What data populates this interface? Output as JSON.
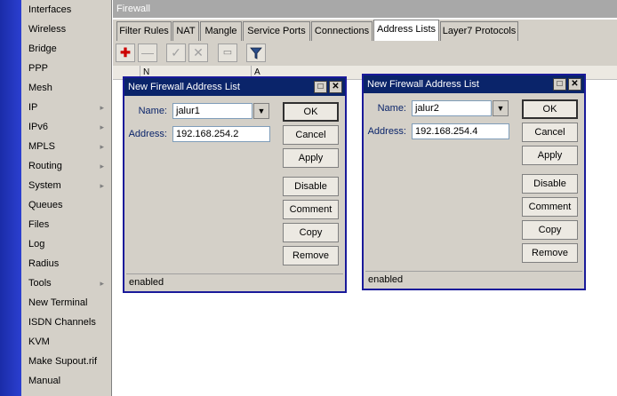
{
  "sidebar": {
    "items": [
      {
        "label": "Interfaces",
        "arrow": ""
      },
      {
        "label": "Wireless",
        "arrow": ""
      },
      {
        "label": "Bridge",
        "arrow": ""
      },
      {
        "label": "PPP",
        "arrow": ""
      },
      {
        "label": "Mesh",
        "arrow": ""
      },
      {
        "label": "IP",
        "arrow": "▸"
      },
      {
        "label": "IPv6",
        "arrow": "▸"
      },
      {
        "label": "MPLS",
        "arrow": "▸"
      },
      {
        "label": "Routing",
        "arrow": "▸"
      },
      {
        "label": "System",
        "arrow": "▸"
      },
      {
        "label": "Queues",
        "arrow": ""
      },
      {
        "label": "Files",
        "arrow": ""
      },
      {
        "label": "Log",
        "arrow": ""
      },
      {
        "label": "Radius",
        "arrow": ""
      },
      {
        "label": "Tools",
        "arrow": "▸"
      },
      {
        "label": "New Terminal",
        "arrow": ""
      },
      {
        "label": "ISDN Channels",
        "arrow": ""
      },
      {
        "label": "KVM",
        "arrow": ""
      },
      {
        "label": "Make Supout.rif",
        "arrow": ""
      },
      {
        "label": "Manual",
        "arrow": ""
      }
    ]
  },
  "firewall": {
    "title": "Firewall",
    "tabs": [
      "Filter Rules",
      "NAT",
      "Mangle",
      "Service Ports",
      "Connections",
      "Address Lists",
      "Layer7 Protocols"
    ],
    "active_tab": "Address Lists",
    "toolbar": {
      "add_icon": "plus-icon",
      "remove_icon": "minus-icon",
      "enable_icon": "check-icon",
      "disable_icon": "x-icon",
      "comment_icon": "comment-icon",
      "filter_icon": "filter-icon"
    },
    "columns": [
      "N",
      "A"
    ]
  },
  "dialogs": [
    {
      "title": "New Firewall Address List",
      "name_label": "Name:",
      "name_value": "jalur1",
      "address_label": "Address:",
      "address_value": "192.168.254.2",
      "buttons": [
        "OK",
        "Cancel",
        "Apply",
        "Disable",
        "Comment",
        "Copy",
        "Remove"
      ],
      "status": "enabled"
    },
    {
      "title": "New Firewall Address List",
      "name_label": "Name:",
      "name_value": "jalur2",
      "address_label": "Address:",
      "address_value": "192.168.254.4",
      "buttons": [
        "OK",
        "Cancel",
        "Apply",
        "Disable",
        "Comment",
        "Copy",
        "Remove"
      ],
      "status": "enabled"
    }
  ],
  "colors": {
    "sidebar_strip": "#1a2ca8",
    "dialog_title": "#0a246a",
    "label_blue": "#0a246a",
    "add_red": "#cc0000"
  }
}
